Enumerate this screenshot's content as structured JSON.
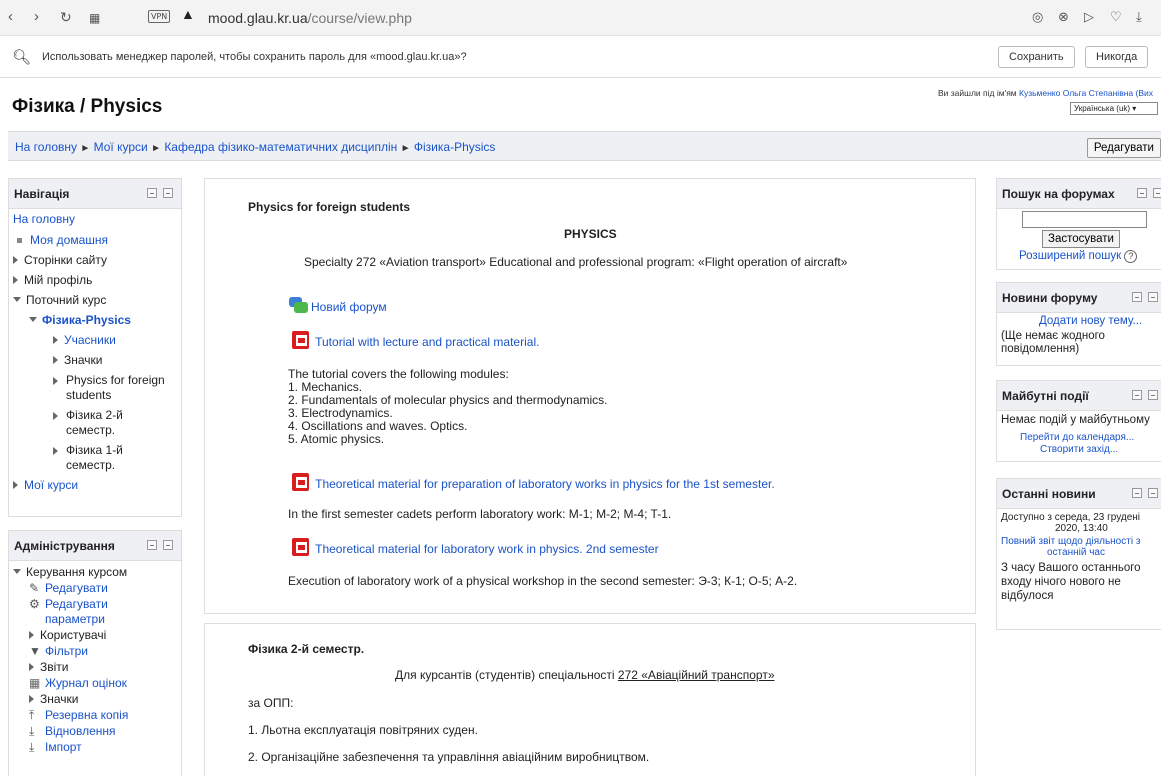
{
  "browser": {
    "url_host": "mood.glau.kr.ua",
    "url_path": "/course/view.php",
    "vpn_label": "VPN"
  },
  "password_bar": {
    "message": "Использовать менеджер паролей, чтобы сохранить пароль для «mood.glau.kr.ua»?",
    "save_label": "Сохранить",
    "never_label": "Никогда"
  },
  "header": {
    "site_title": "Фізика / Physics",
    "login_prefix": "Ви зайшли під ім'ям",
    "user_name": "Кузьменко Ольга Степанівна (Вих",
    "language": "Українська (uk)"
  },
  "breadcrumb": {
    "items": [
      "На головну",
      "Мої курси",
      "Кафедра фізико-математичних дисциплін",
      "Фізика-Physics"
    ],
    "separator": "►",
    "edit_label": "Редагувати"
  },
  "navigation_block": {
    "title": "Навігація",
    "home": "На головну",
    "my_home": "Моя домашня",
    "site_pages": "Сторінки сайту",
    "my_profile": "Мій профіль",
    "current_course": "Поточний курс",
    "course_name": "Фізика-Physics",
    "participants": "Учасники",
    "badges": "Значки",
    "section_1": "Physics for foreign students",
    "section_2": "Фізика 2-й семестр.",
    "section_3": "Фізика 1-й семестр.",
    "my_courses": "Мої курси"
  },
  "admin_block": {
    "title": "Адміністрування",
    "course_admin": "Керування курсом",
    "edit": "Редагувати",
    "edit_settings": "Редагувати параметри",
    "users": "Користувачі",
    "filters": "Фільтри",
    "reports": "Звіти",
    "gradebook": "Журнал оцінок",
    "badges": "Значки",
    "backup": "Резервна копія",
    "restore": "Відновлення",
    "import": "Імпорт"
  },
  "section_foreign": {
    "title": "Physics for foreign students",
    "heading": "PHYSICS",
    "specialty": "Specialty 272 «Aviation transport» Educational and professional program: «Flight operation of aircraft»",
    "forum_link": "Новий форум",
    "tutorial_link": "Tutorial with lecture and practical material.",
    "modules_intro": "The tutorial covers the following modules:",
    "modules": [
      "1. Mechanics.",
      "2. Fundamentals of molecular physics and thermodynamics.",
      "3. Electrodynamics.",
      "4. Oscillations and waves. Optics.",
      "5. Atomic physics."
    ],
    "lab1_link": "Theoretical material for preparation of laboratory works in physics for the 1st semester.",
    "lab1_text": "In the first semester cadets perform laboratory work: M-1; M-2; M-4; T-1.",
    "lab2_link": "Theoretical material for laboratory work in physics. 2nd semester",
    "lab2_text": "Execution of laboratory work of a physical workshop in the second semester: Э-3; К-1; О-5; А-2."
  },
  "section_sem2": {
    "title": "Фізика 2-й семестр.",
    "intro": "Для курсантів (студентів) спеціальності",
    "specialty_link": "272 «Авіаційний транспорт»",
    "opp": "за ОПП:",
    "item1": "1. Льотна експлуатація повітряних суден.",
    "item2": "2. Організаційне забезпечення та управління авіаційним виробництвом."
  },
  "search_block": {
    "title": "Пошук на форумах",
    "input_value": "",
    "apply_label": "Застосувати",
    "advanced_label": "Розширений пошук",
    "help_icon": "?"
  },
  "news_block": {
    "title": "Новини форуму",
    "add_topic": "Додати нову тему...",
    "empty": "(Ще немає жодного повідомлення)"
  },
  "events_block": {
    "title": "Майбутні події",
    "empty": "Немає подій у майбутньому",
    "go_calendar": "Перейти до календаря...",
    "create_event": "Створити захід..."
  },
  "recent_block": {
    "title": "Останні новини",
    "since": "Доступно з середа, 23 грудені",
    "time": "2020, 13:40",
    "full_report": "Повний звіт щодо діяльності з",
    "full_report_2": "останній час",
    "nothing_new": "З часу Вашого останнього входу нічого нового не відбулося"
  }
}
